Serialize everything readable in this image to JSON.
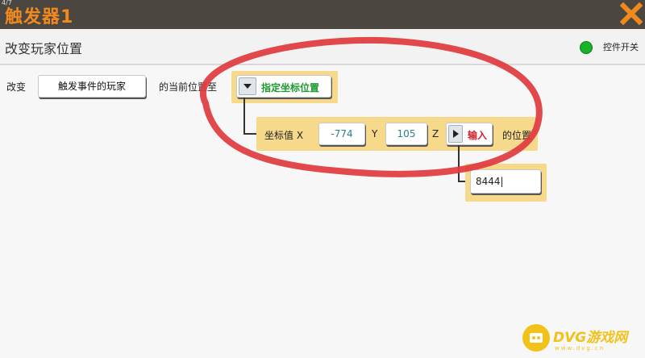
{
  "window": {
    "title": "触发器1",
    "corner_text": "4/7",
    "close_icon": "close-x-icon"
  },
  "header": {
    "subtitle": "改变玩家位置",
    "toggle_label": "控件开关",
    "toggle_color": "#19b32a"
  },
  "action": {
    "verb": "改变",
    "target_button": "触发事件的玩家",
    "middle_text": "的当前位置至",
    "dropdown_label": "指定坐标位置"
  },
  "coords": {
    "prefix": "坐标值 X",
    "x_value": "-774",
    "y_label": "Y",
    "y_value": "105",
    "z_label": "Z",
    "z_dropdown_label": "输入",
    "suffix": "的位置"
  },
  "z_input": {
    "value": "8444"
  },
  "watermark": {
    "text": "DVG游戏网",
    "sub": "www.dvg.cn"
  },
  "colors": {
    "title_orange": "#f08a1f",
    "highlight_ellipse": "#e0393e",
    "frame_yellow": "#f6d98b",
    "dropdown_green": "#1c9a2e",
    "value_teal": "#2a7f8a",
    "input_red": "#d4212a"
  }
}
